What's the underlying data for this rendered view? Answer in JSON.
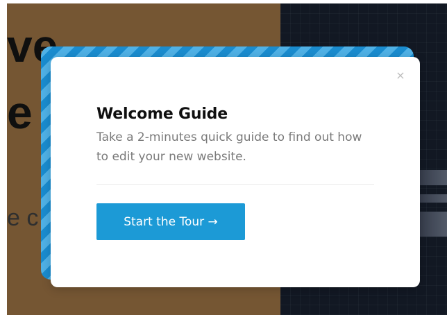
{
  "background": {
    "headline_line1": "ve",
    "headline_line2": "e",
    "subtext": "e c"
  },
  "modal": {
    "close_icon": "×",
    "title": "Welcome Guide",
    "description": "Take a 2-minutes quick guide to find out how to edit your new website.",
    "cta_label": "Start the Tour →"
  },
  "colors": {
    "accent": "#1c9ad6",
    "stripe_dark": "#1a8ccf",
    "stripe_light": "#4fb1e6",
    "bg_left": "#7f5e38",
    "bg_right": "#141b27"
  }
}
